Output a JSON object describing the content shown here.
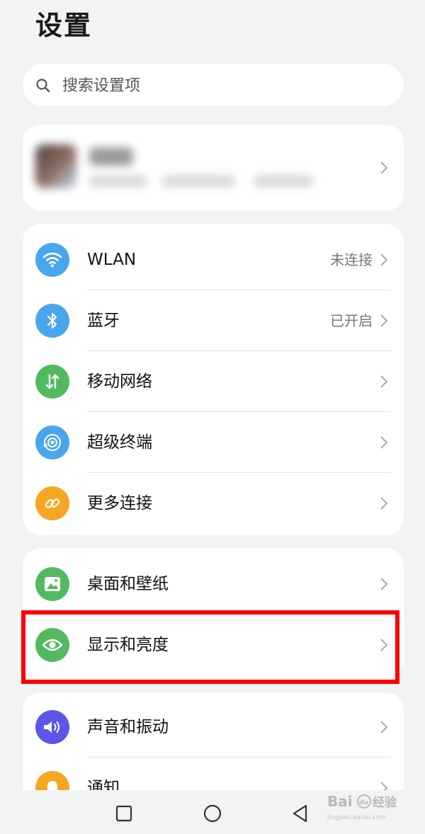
{
  "page": {
    "title": "设置"
  },
  "search": {
    "placeholder": "搜索设置项"
  },
  "group1": {
    "items": [
      {
        "label": "WLAN",
        "value": "未连接",
        "icon": "wifi-icon",
        "color": "#4aa6ec"
      },
      {
        "label": "蓝牙",
        "value": "已开启",
        "icon": "bluetooth-icon",
        "color": "#4aa6ec"
      },
      {
        "label": "移动网络",
        "value": "",
        "icon": "mobile-network-icon",
        "color": "#53b95f"
      },
      {
        "label": "超级终端",
        "value": "",
        "icon": "super-device-icon",
        "color": "#4aa6ec"
      },
      {
        "label": "更多连接",
        "value": "",
        "icon": "link-icon",
        "color": "#f5a623"
      }
    ]
  },
  "group2": {
    "items": [
      {
        "label": "桌面和壁纸",
        "icon": "wallpaper-icon",
        "color": "#53b95f"
      },
      {
        "label": "显示和亮度",
        "icon": "eye-icon",
        "color": "#53b95f"
      }
    ]
  },
  "group3": {
    "items": [
      {
        "label": "声音和振动",
        "icon": "speaker-icon",
        "color": "#5b55e8"
      },
      {
        "label": "通知",
        "icon": "notification-icon",
        "color": "#f5a623"
      }
    ]
  },
  "highlight_color": "#ff0000",
  "watermark": {
    "brand": "Bai",
    "paw_text": "du",
    "cn": "经验",
    "url": "jingyan.baidu.com"
  }
}
